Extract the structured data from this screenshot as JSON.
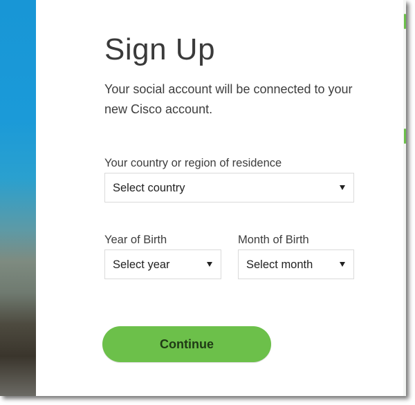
{
  "signup": {
    "title": "Sign Up",
    "intro": "Your social account will be connected to your new Cisco account."
  },
  "country": {
    "label": "Your country or region of residence",
    "selected": "Select country"
  },
  "year": {
    "label": "Year of Birth",
    "selected": "Select year"
  },
  "month": {
    "label": "Month of Birth",
    "selected": "Select month"
  },
  "actions": {
    "continue_label": "Continue"
  },
  "colors": {
    "accent_green": "#6cc04a",
    "background_blue": "#1896d6"
  }
}
